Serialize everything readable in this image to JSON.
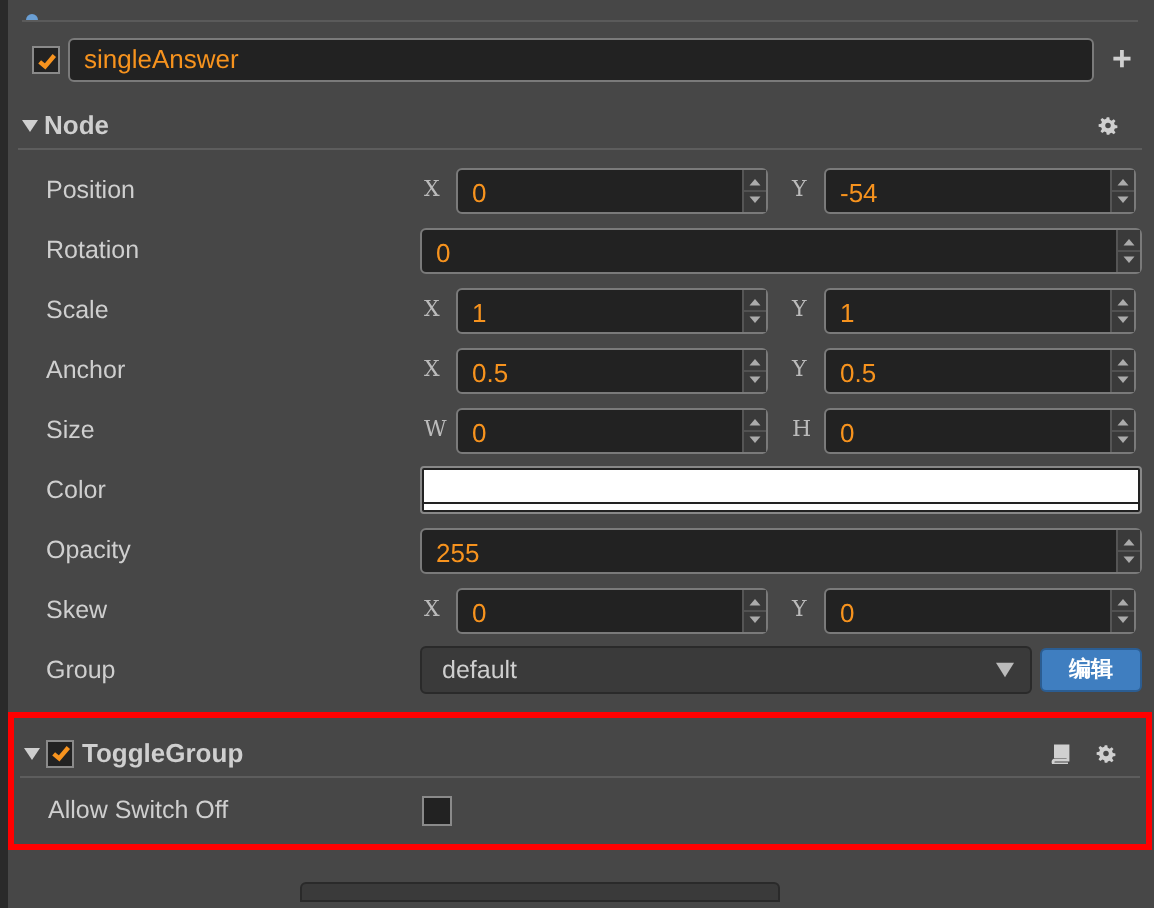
{
  "node_name": {
    "enabled": true,
    "value": "singleAnswer",
    "add": "+"
  },
  "node_section": {
    "title": "Node",
    "expanded": true,
    "properties": [
      {
        "kind": "vec2",
        "label": "Position",
        "fields": [
          {
            "axis": "X",
            "value": "0"
          },
          {
            "axis": "Y",
            "value": "-54"
          }
        ]
      },
      {
        "kind": "number",
        "label": "Rotation",
        "value": "0"
      },
      {
        "kind": "vec2",
        "label": "Scale",
        "fields": [
          {
            "axis": "X",
            "value": "1"
          },
          {
            "axis": "Y",
            "value": "1"
          }
        ]
      },
      {
        "kind": "vec2",
        "label": "Anchor",
        "fields": [
          {
            "axis": "X",
            "value": "0.5"
          },
          {
            "axis": "Y",
            "value": "0.5"
          }
        ]
      },
      {
        "kind": "vec2",
        "label": "Size",
        "fields": [
          {
            "axis": "W",
            "value": "0"
          },
          {
            "axis": "H",
            "value": "0"
          }
        ]
      },
      {
        "kind": "color",
        "label": "Color",
        "color": "#ffffff"
      },
      {
        "kind": "number",
        "label": "Opacity",
        "value": "255"
      },
      {
        "kind": "vec2",
        "label": "Skew",
        "fields": [
          {
            "axis": "X",
            "value": "0"
          },
          {
            "axis": "Y",
            "value": "0"
          }
        ]
      },
      {
        "kind": "select",
        "label": "Group",
        "value": "default",
        "button": "编辑"
      }
    ]
  },
  "component": {
    "title": "ToggleGroup",
    "enabled": true,
    "expanded": true,
    "highlighted": true,
    "properties": [
      {
        "kind": "checkbox",
        "label": "Allow Switch Off",
        "checked": false
      }
    ]
  }
}
